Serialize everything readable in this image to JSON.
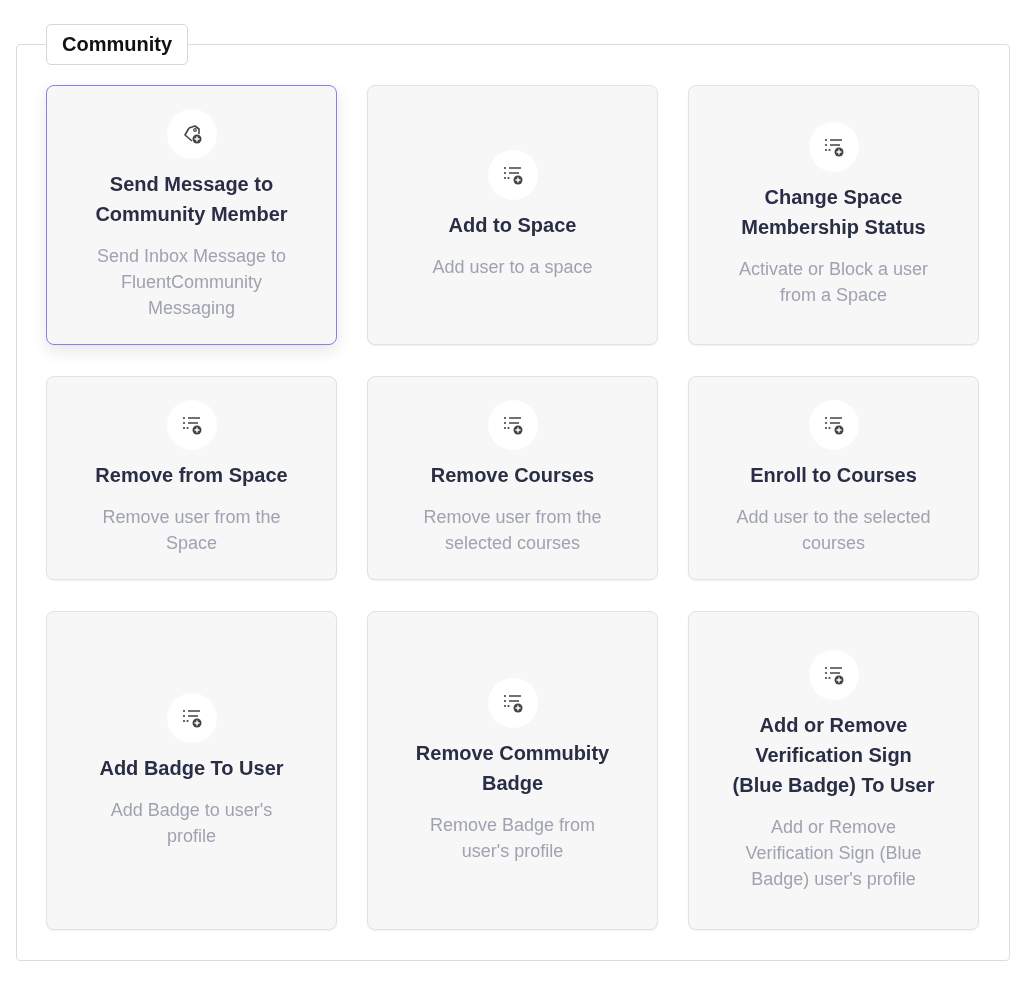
{
  "section": {
    "title": "Community"
  },
  "cards": [
    {
      "kind": "tag",
      "title": "Send Message to Community Member",
      "description": "Send Inbox Message to FluentCommunity Messaging",
      "selected": true
    },
    {
      "kind": "list",
      "title": "Add to Space",
      "description": "Add user to a space",
      "selected": false
    },
    {
      "kind": "list",
      "title": "Change Space Membership Status",
      "description": "Activate or Block a user from a Space",
      "selected": false
    },
    {
      "kind": "list",
      "title": "Remove from Space",
      "description": "Remove user from the Space",
      "selected": false
    },
    {
      "kind": "list",
      "title": "Remove Courses",
      "description": "Remove user from the selected courses",
      "selected": false
    },
    {
      "kind": "list",
      "title": "Enroll to Courses",
      "description": "Add user to the selected courses",
      "selected": false
    },
    {
      "kind": "list",
      "title": "Add Badge To User",
      "description": "Add Badge to user's profile",
      "selected": false
    },
    {
      "kind": "list",
      "title": "Remove Commubity Badge",
      "description": "Remove Badge from user's profile",
      "selected": false
    },
    {
      "kind": "list",
      "title": "Add or Remove Verification Sign (Blue Badge) To User",
      "description": "Add or Remove Verification Sign (Blue Badge) user's profile",
      "selected": false
    }
  ]
}
